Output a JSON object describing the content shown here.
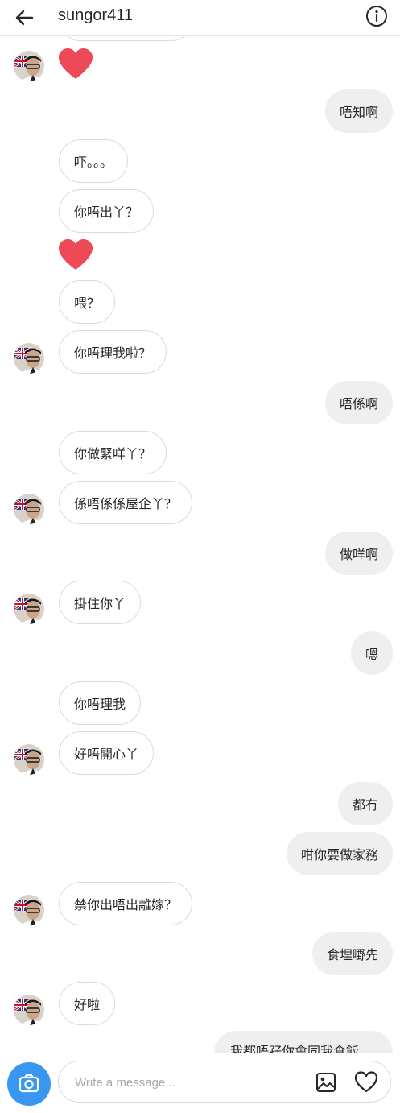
{
  "header": {
    "username": "sungor411",
    "back_icon": "arrow-left-icon",
    "info_icon": "info-icon"
  },
  "messages": [
    {
      "side": "in",
      "type": "heart"
    },
    {
      "side": "out",
      "text": "唔知啊"
    },
    {
      "side": "in",
      "text": "吓。。。"
    },
    {
      "side": "in",
      "text": "你唔出丫？"
    },
    {
      "side": "in",
      "type": "heart"
    },
    {
      "side": "in",
      "text": "喂？"
    },
    {
      "side": "in",
      "text": "你唔理我啦？"
    },
    {
      "side": "out",
      "text": "唔係啊"
    },
    {
      "side": "in",
      "text": "你做緊咩丫？"
    },
    {
      "side": "in",
      "text": "係唔係係屋企丫？"
    },
    {
      "side": "out",
      "text": "做咩啊"
    },
    {
      "side": "in",
      "text": "掛住你丫"
    },
    {
      "side": "out",
      "text": "嗯"
    },
    {
      "side": "in",
      "text": "你唔理我"
    },
    {
      "side": "in",
      "text": "好唔開心丫"
    },
    {
      "side": "out",
      "text": "都冇"
    },
    {
      "side": "out",
      "text": "咁你要做家務"
    },
    {
      "side": "in",
      "text": "禁你出唔出離嫁？"
    },
    {
      "side": "out",
      "text": "食埋嘢先"
    },
    {
      "side": "in",
      "text": "好啦"
    },
    {
      "side": "out",
      "text": "我都唔孖你會同我食飯",
      "partial": true
    }
  ],
  "composer": {
    "placeholder": "Write a message...",
    "camera_icon": "camera-icon",
    "gallery_icon": "image-gallery-icon",
    "like_icon": "heart-icon"
  },
  "colors": {
    "accent": "#3897f0",
    "heart": "#ed4956",
    "outgoing_bubble": "#efefef",
    "border": "#dbdbdb"
  }
}
